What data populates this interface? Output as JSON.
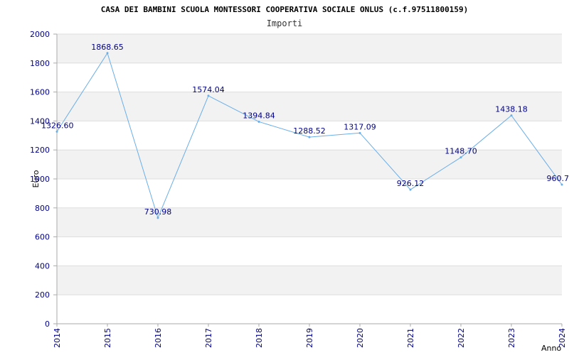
{
  "chart_data": {
    "type": "line",
    "title": "CASA DEI BAMBINI SCUOLA MONTESSORI COOPERATIVA SOCIALE ONLUS (c.f.97511800159)",
    "subtitle": "Importi",
    "xlabel": "Anno",
    "ylabel": "Euro",
    "categories": [
      "2014",
      "2015",
      "2016",
      "2017",
      "2018",
      "2019",
      "2020",
      "2021",
      "2022",
      "2023",
      "2024"
    ],
    "series": [
      {
        "values": [
          1326.6,
          1868.65,
          730.98,
          1574.04,
          1394.84,
          1288.52,
          1317.09,
          926.12,
          1148.7,
          1438.18,
          960.7
        ],
        "labels": [
          "1326.60",
          "1868.65",
          "730.98",
          "1574.04",
          "1394.84",
          "1288.52",
          "1317.09",
          "926.12",
          "1148.70",
          "1438.18",
          "960.7"
        ]
      }
    ],
    "ylim": [
      0,
      2000
    ],
    "yticks": [
      "0",
      "200",
      "400",
      "600",
      "800",
      "1000",
      "1200",
      "1400",
      "1600",
      "1800",
      "2000"
    ],
    "grid": true,
    "colors": {
      "line": "#6aaee8",
      "band": "#f2f2f2",
      "tick": "#00008b",
      "grid": "#dddddd",
      "axis": "#aaaaaa"
    }
  }
}
